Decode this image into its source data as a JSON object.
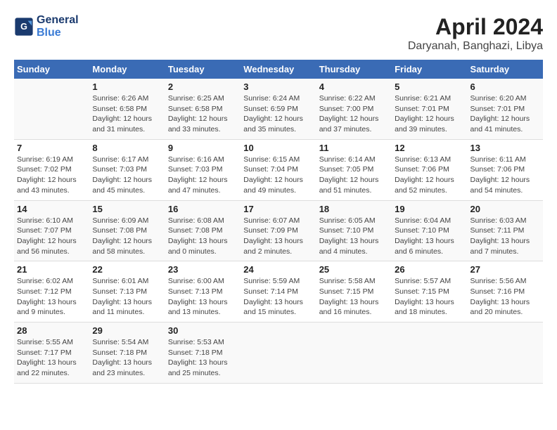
{
  "logo": {
    "line1": "General",
    "line2": "Blue"
  },
  "title": "April 2024",
  "subtitle": "Daryanah, Banghazi, Libya",
  "days_of_week": [
    "Sunday",
    "Monday",
    "Tuesday",
    "Wednesday",
    "Thursday",
    "Friday",
    "Saturday"
  ],
  "weeks": [
    [
      {
        "day": "",
        "info": ""
      },
      {
        "day": "1",
        "info": "Sunrise: 6:26 AM\nSunset: 6:58 PM\nDaylight: 12 hours\nand 31 minutes."
      },
      {
        "day": "2",
        "info": "Sunrise: 6:25 AM\nSunset: 6:58 PM\nDaylight: 12 hours\nand 33 minutes."
      },
      {
        "day": "3",
        "info": "Sunrise: 6:24 AM\nSunset: 6:59 PM\nDaylight: 12 hours\nand 35 minutes."
      },
      {
        "day": "4",
        "info": "Sunrise: 6:22 AM\nSunset: 7:00 PM\nDaylight: 12 hours\nand 37 minutes."
      },
      {
        "day": "5",
        "info": "Sunrise: 6:21 AM\nSunset: 7:01 PM\nDaylight: 12 hours\nand 39 minutes."
      },
      {
        "day": "6",
        "info": "Sunrise: 6:20 AM\nSunset: 7:01 PM\nDaylight: 12 hours\nand 41 minutes."
      }
    ],
    [
      {
        "day": "7",
        "info": "Sunrise: 6:19 AM\nSunset: 7:02 PM\nDaylight: 12 hours\nand 43 minutes."
      },
      {
        "day": "8",
        "info": "Sunrise: 6:17 AM\nSunset: 7:03 PM\nDaylight: 12 hours\nand 45 minutes."
      },
      {
        "day": "9",
        "info": "Sunrise: 6:16 AM\nSunset: 7:03 PM\nDaylight: 12 hours\nand 47 minutes."
      },
      {
        "day": "10",
        "info": "Sunrise: 6:15 AM\nSunset: 7:04 PM\nDaylight: 12 hours\nand 49 minutes."
      },
      {
        "day": "11",
        "info": "Sunrise: 6:14 AM\nSunset: 7:05 PM\nDaylight: 12 hours\nand 51 minutes."
      },
      {
        "day": "12",
        "info": "Sunrise: 6:13 AM\nSunset: 7:06 PM\nDaylight: 12 hours\nand 52 minutes."
      },
      {
        "day": "13",
        "info": "Sunrise: 6:11 AM\nSunset: 7:06 PM\nDaylight: 12 hours\nand 54 minutes."
      }
    ],
    [
      {
        "day": "14",
        "info": "Sunrise: 6:10 AM\nSunset: 7:07 PM\nDaylight: 12 hours\nand 56 minutes."
      },
      {
        "day": "15",
        "info": "Sunrise: 6:09 AM\nSunset: 7:08 PM\nDaylight: 12 hours\nand 58 minutes."
      },
      {
        "day": "16",
        "info": "Sunrise: 6:08 AM\nSunset: 7:08 PM\nDaylight: 13 hours\nand 0 minutes."
      },
      {
        "day": "17",
        "info": "Sunrise: 6:07 AM\nSunset: 7:09 PM\nDaylight: 13 hours\nand 2 minutes."
      },
      {
        "day": "18",
        "info": "Sunrise: 6:05 AM\nSunset: 7:10 PM\nDaylight: 13 hours\nand 4 minutes."
      },
      {
        "day": "19",
        "info": "Sunrise: 6:04 AM\nSunset: 7:10 PM\nDaylight: 13 hours\nand 6 minutes."
      },
      {
        "day": "20",
        "info": "Sunrise: 6:03 AM\nSunset: 7:11 PM\nDaylight: 13 hours\nand 7 minutes."
      }
    ],
    [
      {
        "day": "21",
        "info": "Sunrise: 6:02 AM\nSunset: 7:12 PM\nDaylight: 13 hours\nand 9 minutes."
      },
      {
        "day": "22",
        "info": "Sunrise: 6:01 AM\nSunset: 7:13 PM\nDaylight: 13 hours\nand 11 minutes."
      },
      {
        "day": "23",
        "info": "Sunrise: 6:00 AM\nSunset: 7:13 PM\nDaylight: 13 hours\nand 13 minutes."
      },
      {
        "day": "24",
        "info": "Sunrise: 5:59 AM\nSunset: 7:14 PM\nDaylight: 13 hours\nand 15 minutes."
      },
      {
        "day": "25",
        "info": "Sunrise: 5:58 AM\nSunset: 7:15 PM\nDaylight: 13 hours\nand 16 minutes."
      },
      {
        "day": "26",
        "info": "Sunrise: 5:57 AM\nSunset: 7:15 PM\nDaylight: 13 hours\nand 18 minutes."
      },
      {
        "day": "27",
        "info": "Sunrise: 5:56 AM\nSunset: 7:16 PM\nDaylight: 13 hours\nand 20 minutes."
      }
    ],
    [
      {
        "day": "28",
        "info": "Sunrise: 5:55 AM\nSunset: 7:17 PM\nDaylight: 13 hours\nand 22 minutes."
      },
      {
        "day": "29",
        "info": "Sunrise: 5:54 AM\nSunset: 7:18 PM\nDaylight: 13 hours\nand 23 minutes."
      },
      {
        "day": "30",
        "info": "Sunrise: 5:53 AM\nSunset: 7:18 PM\nDaylight: 13 hours\nand 25 minutes."
      },
      {
        "day": "",
        "info": ""
      },
      {
        "day": "",
        "info": ""
      },
      {
        "day": "",
        "info": ""
      },
      {
        "day": "",
        "info": ""
      }
    ]
  ]
}
